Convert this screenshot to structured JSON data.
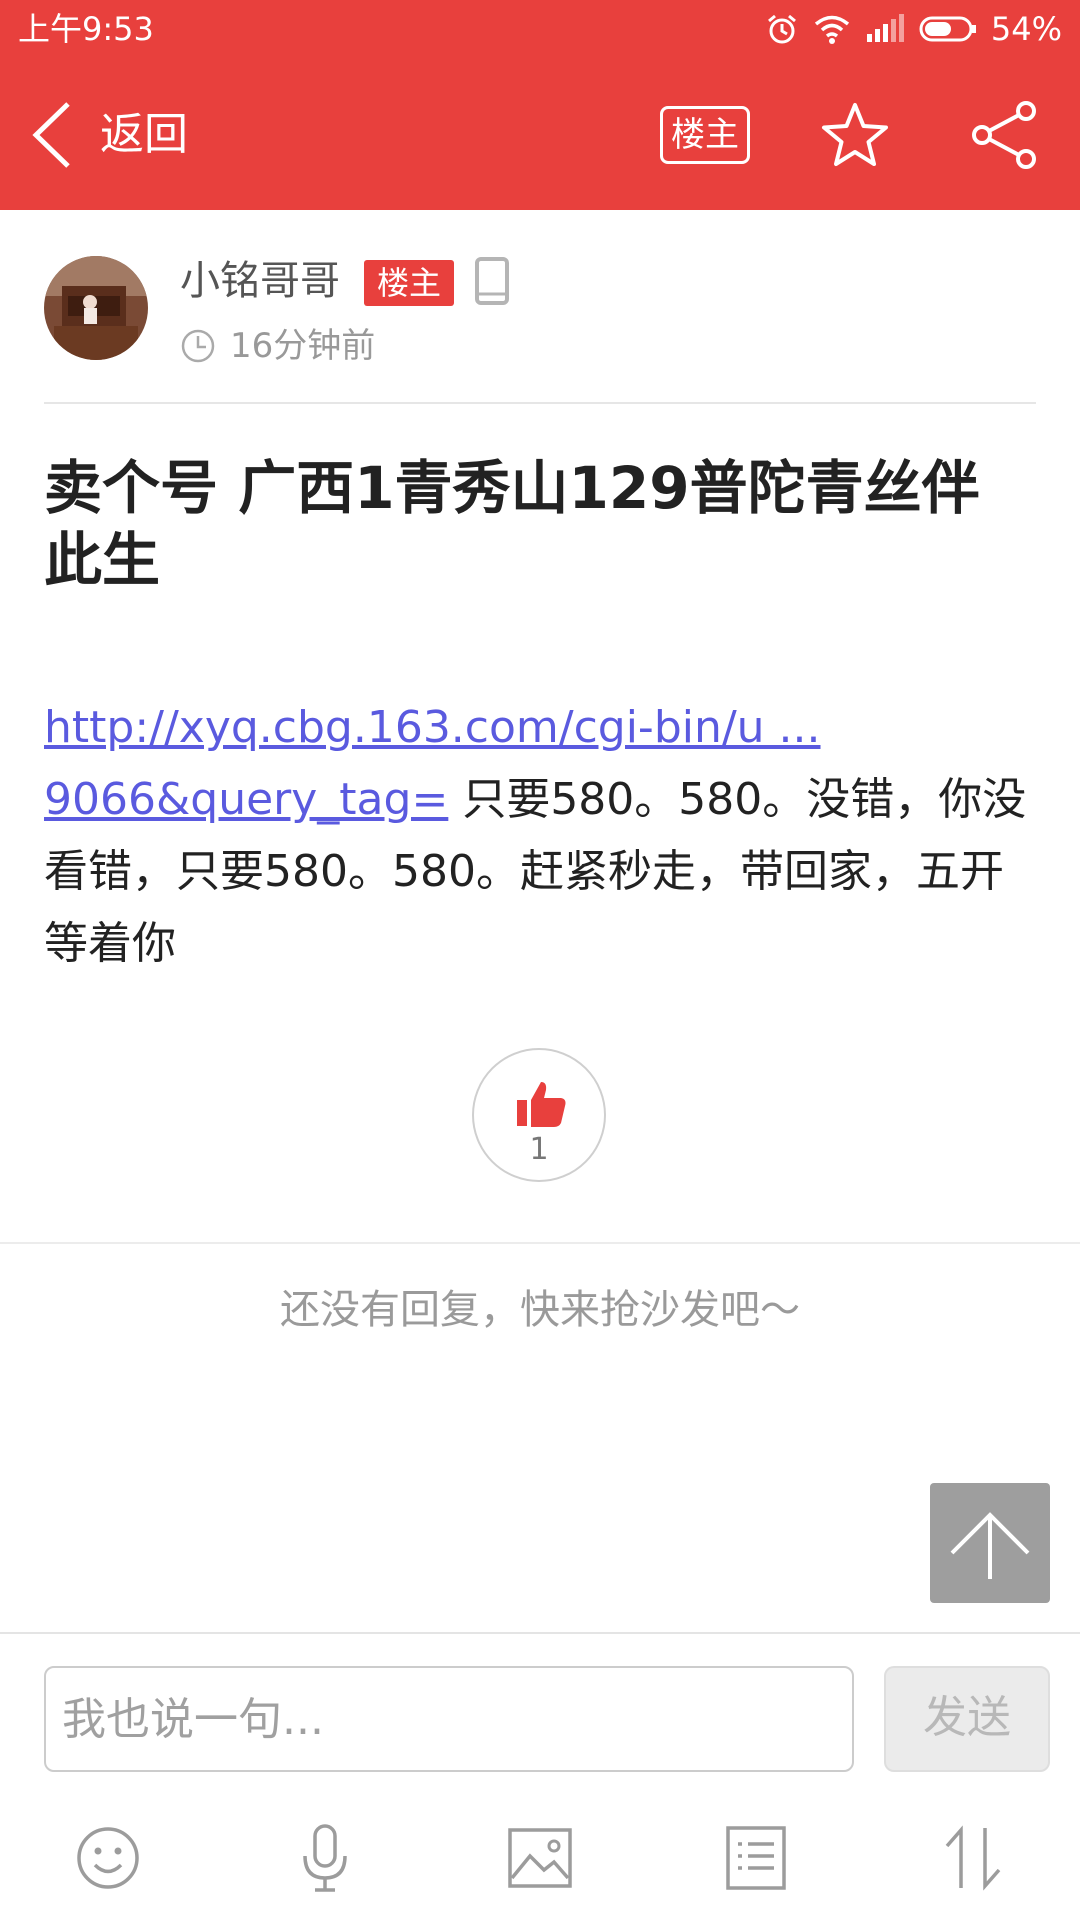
{
  "status_bar": {
    "time": "上午9:53",
    "battery": "54%"
  },
  "header": {
    "back_label": "返回",
    "owner_only_label": "楼主",
    "icons": [
      "chevron-left-icon",
      "star-icon",
      "share-icon"
    ]
  },
  "post": {
    "author": {
      "name": "小铭哥哥",
      "badge": "楼主",
      "time": "16分钟前"
    },
    "title": "卖个号 广西1青秀山129普陀青丝伴此生",
    "link_line1": "http://xyq.cbg.163.com/cgi-bin/u ...",
    "link_line2": "9066&query_tag=",
    "body_text": " 只要580。580。没错，你没看错，只要580。580。赶紧秒走，带回家，五开等着你",
    "likes": "1"
  },
  "replies": {
    "empty_message": "还没有回复，快来抢沙发吧～"
  },
  "reply_bar": {
    "placeholder": "我也说一句...",
    "send_label": "发送"
  },
  "toolbar": {
    "icons": [
      "emoji-icon",
      "microphone-icon",
      "image-icon",
      "list-icon",
      "sort-icon"
    ]
  },
  "colors": {
    "brand": "#e8403d",
    "link": "#5a5adf"
  }
}
